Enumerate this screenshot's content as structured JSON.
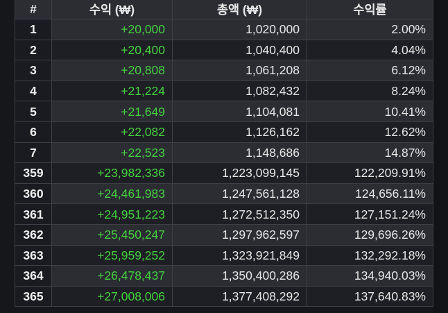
{
  "table": {
    "headers": [
      "#",
      "수익 (₩)",
      "총액 (₩)",
      "수익률"
    ],
    "rows": [
      [
        "1",
        "+20,000",
        "1,020,000",
        "2.00%"
      ],
      [
        "2",
        "+20,400",
        "1,040,400",
        "4.04%"
      ],
      [
        "3",
        "+20,808",
        "1,061,208",
        "6.12%"
      ],
      [
        "4",
        "+21,224",
        "1,082,432",
        "8.24%"
      ],
      [
        "5",
        "+21,649",
        "1,104,081",
        "10.41%"
      ],
      [
        "6",
        "+22,082",
        "1,126,162",
        "12.62%"
      ],
      [
        "7",
        "+22,523",
        "1,148,686",
        "14.87%"
      ],
      [
        "359",
        "+23,982,336",
        "1,223,099,145",
        "122,209.91%"
      ],
      [
        "360",
        "+24,461,983",
        "1,247,561,128",
        "124,656.11%"
      ],
      [
        "361",
        "+24,951,223",
        "1,272,512,350",
        "127,151.24%"
      ],
      [
        "362",
        "+25,450,247",
        "1,297,962,597",
        "129,696.26%"
      ],
      [
        "363",
        "+25,959,252",
        "1,323,921,849",
        "132,292.18%"
      ],
      [
        "364",
        "+26,478,437",
        "1,350,400,286",
        "134,940.03%"
      ],
      [
        "365",
        "+27,008,006",
        "1,377,408,292",
        "137,640.83%"
      ]
    ]
  },
  "colors": {
    "background": "#16171a",
    "header_bg": "#2b2d33",
    "row_alt_bg": "#1e1f24",
    "profit_green": "#45d13f",
    "text": "#e6e6e6",
    "border": "#3e4046"
  }
}
